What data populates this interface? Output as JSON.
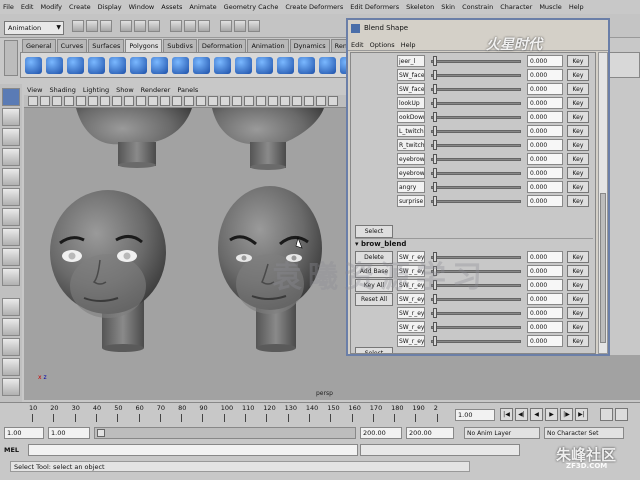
{
  "app": {
    "menu": [
      "File",
      "Edit",
      "Modify",
      "Create",
      "Display",
      "Window",
      "Assets",
      "Animate",
      "Geometry Cache",
      "Create Deformers",
      "Edit Deformers",
      "Skeleton",
      "Skin",
      "Constrain",
      "Character",
      "Muscle",
      "Help"
    ],
    "mode": "Animation"
  },
  "shelf": {
    "tabs": [
      "General",
      "Curves",
      "Surfaces",
      "Polygons",
      "Subdivs",
      "Deformation",
      "Animation",
      "Dynamics",
      "Rendering"
    ],
    "active_tab": "Polygons"
  },
  "viewport": {
    "menu": [
      "View",
      "Shading",
      "Lighting",
      "Show",
      "Renderer",
      "Panels"
    ],
    "camera_label": "persp",
    "axis_x": "x",
    "axis_z": "z"
  },
  "blend_shape": {
    "title": "Blend Shape",
    "menu": [
      "Edit",
      "Options",
      "Help"
    ],
    "upper_targets": [
      {
        "name": "jeer_l",
        "value": "0.000"
      },
      {
        "name": "SW_face",
        "value": "0.000"
      },
      {
        "name": "SW_face",
        "value": "0.000"
      },
      {
        "name": "lookUp",
        "value": "0.000"
      },
      {
        "name": "ookDown",
        "value": "0.000"
      },
      {
        "name": "L_twitch",
        "value": "0.000"
      },
      {
        "name": "R_twitch",
        "value": "0.000"
      },
      {
        "name": "eyebrow",
        "value": "0.000"
      },
      {
        "name": "eyebrow",
        "value": "0.000"
      },
      {
        "name": "angry",
        "value": "0.000"
      },
      {
        "name": "surprise",
        "value": "0.000"
      }
    ],
    "key_label": "Key",
    "select_label": "Select",
    "node_name": "brow_blend",
    "actions": [
      "Delete",
      "Add Base",
      "Key All",
      "Reset All"
    ],
    "lower_targets": [
      {
        "name": "SW_r_ey",
        "value": "0.000"
      },
      {
        "name": "SW_r_ey",
        "value": "0.000"
      },
      {
        "name": "SW_r_ey",
        "value": "0.000"
      },
      {
        "name": "SW_r_ey",
        "value": "0.000"
      },
      {
        "name": "SW_r_ey",
        "value": "0.000"
      },
      {
        "name": "SW_r_ey",
        "value": "0.000"
      },
      {
        "name": "SW_r_ey",
        "value": "0.000"
      }
    ]
  },
  "timeline": {
    "ticks": [
      "10",
      "20",
      "30",
      "40",
      "50",
      "60",
      "70",
      "80",
      "90",
      "100",
      "110",
      "120",
      "130",
      "140",
      "150",
      "160",
      "170",
      "180",
      "190",
      "2"
    ],
    "current_frame": "1.00",
    "playback_buttons": [
      "|◀",
      "◀|",
      "◀",
      "▶",
      "|▶",
      "▶|"
    ]
  },
  "range": {
    "start": "1.00",
    "playback_start": "1.00",
    "playback_end": "200.00",
    "end": "200.00",
    "anim_layer": "No Anim Layer",
    "character_set": "No Character Set"
  },
  "command_line": {
    "label": "MEL"
  },
  "help_line": {
    "text": "Select Tool: select an object"
  },
  "watermarks": {
    "top_logo": "火星时代",
    "bottom_logo": "朱峰社区",
    "bottom_url": "ZF3D.COM",
    "middle": "袁曦资源学习"
  }
}
